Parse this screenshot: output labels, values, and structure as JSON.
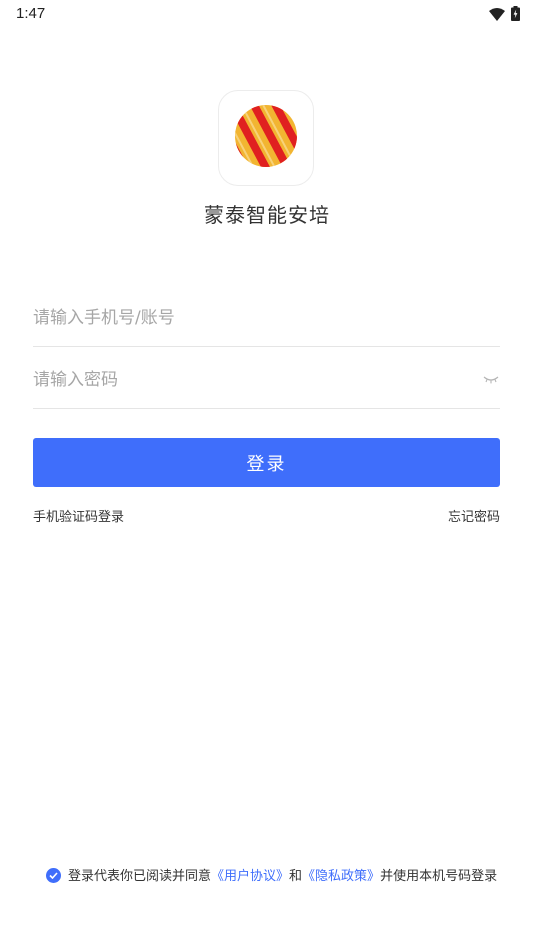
{
  "status_bar": {
    "time": "1:47",
    "icons": [
      "wifi-icon",
      "battery-icon"
    ]
  },
  "app": {
    "name": "蒙泰智能安培",
    "logo_icon": "striped-ball-logo-icon"
  },
  "form": {
    "phone_placeholder": "请输入手机号/账号",
    "phone_value": "",
    "password_placeholder": "请输入密码",
    "password_value": "",
    "login_label": "登录"
  },
  "links": {
    "sms_login": "手机验证码登录",
    "forgot_password": "忘记密码"
  },
  "agreement": {
    "checked": true,
    "prefix": "登录代表你已阅读并同意",
    "user_agreement": "《用户协议》",
    "and": "和",
    "privacy_policy": "《隐私政策》",
    "suffix": "并使用本机号码登录"
  },
  "colors": {
    "primary": "#3f6efb",
    "logo_red": "#e02020",
    "logo_gold": "#f2b531"
  }
}
